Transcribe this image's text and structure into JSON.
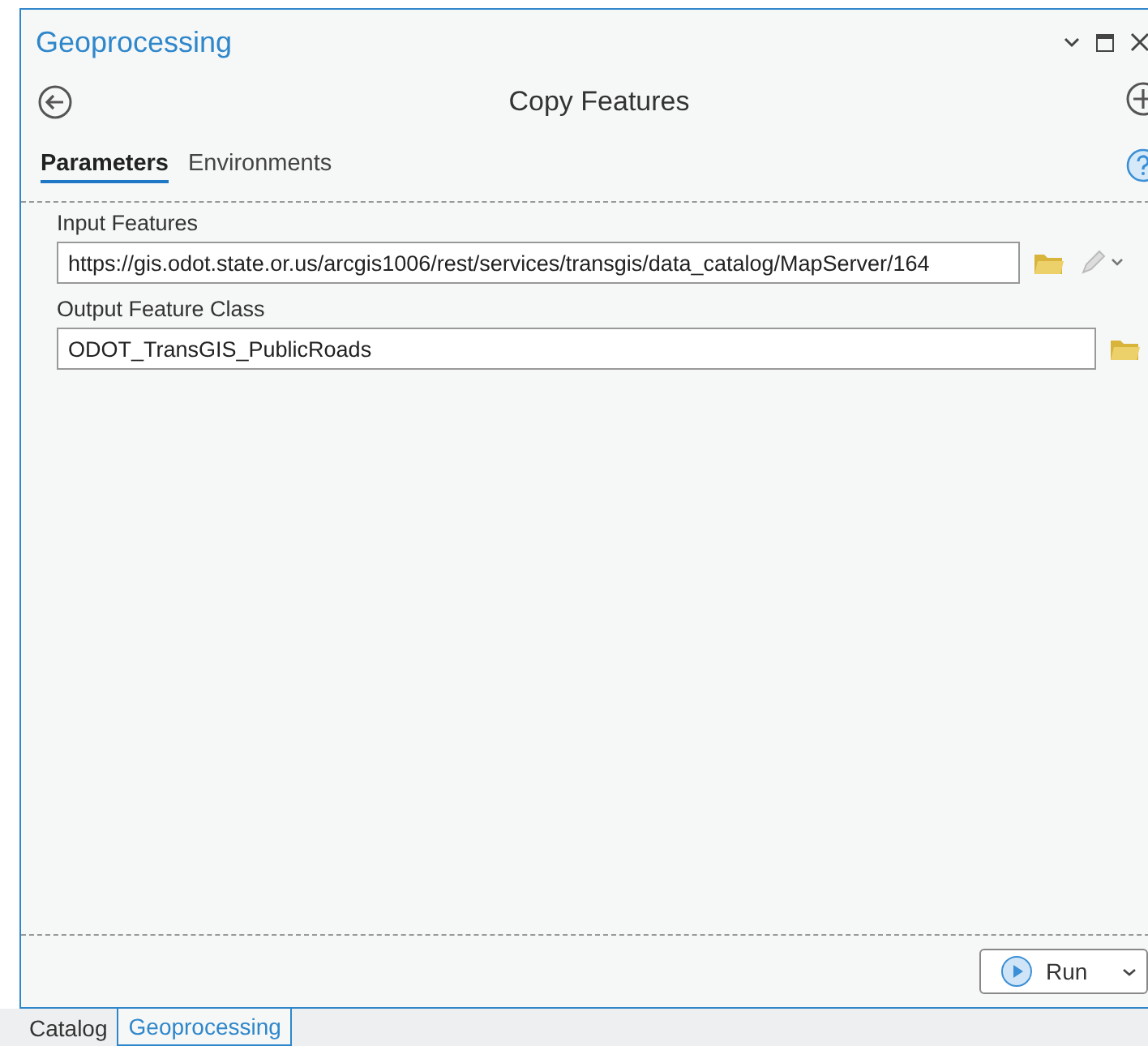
{
  "window": {
    "title": "Geoprocessing"
  },
  "tool": {
    "title": "Copy Features"
  },
  "tabs": [
    {
      "label": "Parameters",
      "selected": true
    },
    {
      "label": "Environments",
      "selected": false
    }
  ],
  "parameters": [
    {
      "label": "Input Features",
      "value": "https://gis.odot.state.or.us/arcgis1006/rest/services/transgis/data_catalog/MapServer/164",
      "kind": "input"
    },
    {
      "label": "Output Feature Class",
      "value": "ODOT_TransGIS_PublicRoads",
      "kind": "output"
    }
  ],
  "run_button": {
    "label": "Run"
  },
  "dock_tabs": [
    {
      "label": "Catalog",
      "selected": false
    },
    {
      "label": "Geoprocessing",
      "selected": true
    }
  ]
}
